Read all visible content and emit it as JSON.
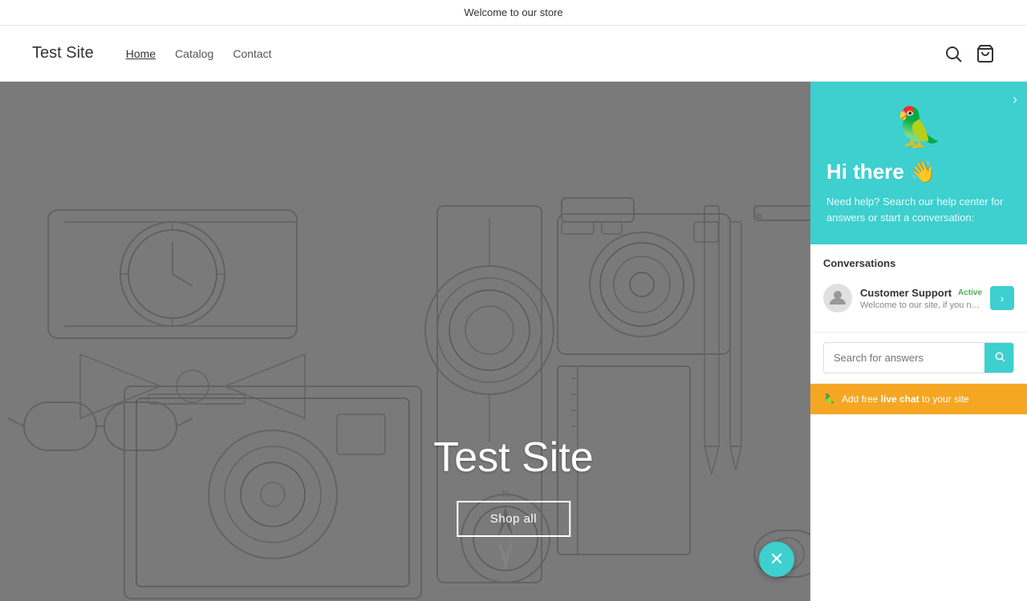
{
  "banner": {
    "text": "Welcome to our store"
  },
  "header": {
    "logo": "Test Site",
    "nav": [
      {
        "label": "Home",
        "active": true
      },
      {
        "label": "Catalog",
        "active": false
      },
      {
        "label": "Contact",
        "active": false
      }
    ],
    "icons": {
      "search": "search-icon",
      "cart": "cart-icon"
    }
  },
  "hero": {
    "title": "Test Site",
    "shop_button": "Shop all"
  },
  "chat": {
    "parrot_emoji": "🦜",
    "greeting": "Hi there 👋",
    "subtitle": "Need help? Search our help center for answers or start a conversation:",
    "conversations_label": "Conversations",
    "conversation": {
      "name": "Customer Support",
      "preview": "Welcome to our site, if you ne...",
      "active_label": "Active"
    },
    "search_placeholder": "Search for answers",
    "footer_banner": {
      "emoji": "🦜",
      "text_before": "Add free ",
      "link_text": "live chat",
      "text_after": " to your site"
    }
  },
  "colors": {
    "teal": "#3ecfcf",
    "orange": "#f5a623",
    "green": "#4caf50"
  }
}
